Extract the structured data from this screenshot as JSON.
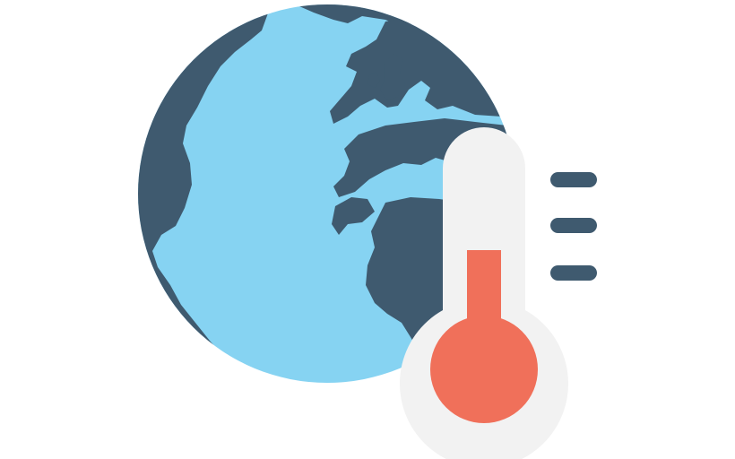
{
  "illustration": {
    "subject": "global-warming-icon",
    "icons": [
      "globe-icon",
      "thermometer-icon"
    ],
    "colors": {
      "ocean": "#86D3F2",
      "land": "#3F5A6F",
      "thermometer_body": "#F2F2F2",
      "mercury": "#F0705A",
      "scale_ticks": "#3F5A6F",
      "background": "#FFFFFF"
    },
    "thermometer": {
      "level": 0.55,
      "tick_count": 3
    }
  }
}
